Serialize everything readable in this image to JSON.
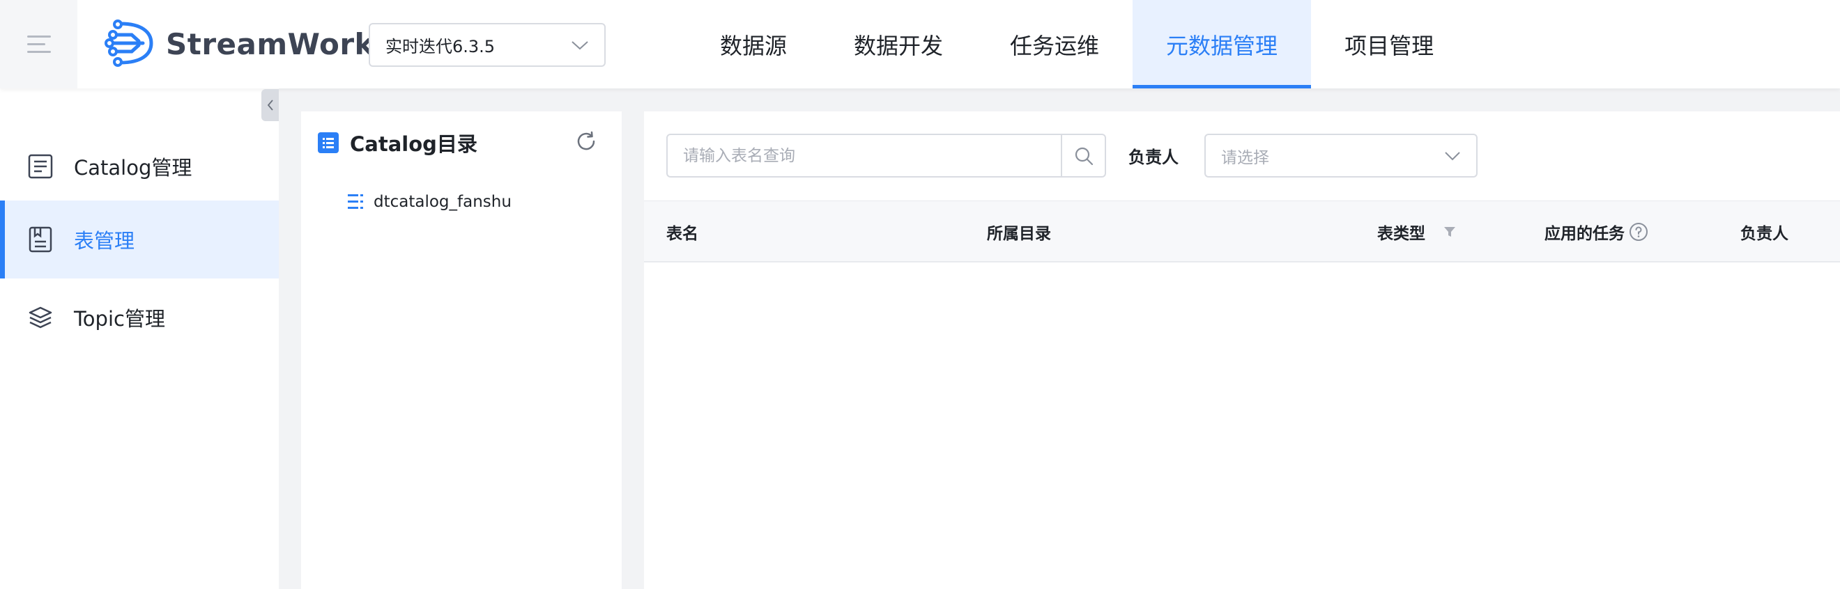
{
  "header": {
    "brand": "StreamWorks",
    "version_select": {
      "value": "实时迭代6.3.5"
    },
    "nav": [
      {
        "label": "数据源",
        "active": false
      },
      {
        "label": "数据开发",
        "active": false
      },
      {
        "label": "任务运维",
        "active": false
      },
      {
        "label": "元数据管理",
        "active": true
      },
      {
        "label": "项目管理",
        "active": false
      }
    ]
  },
  "sidebar": {
    "items": [
      {
        "label": "Catalog管理",
        "icon": "catalog-doc-icon",
        "active": false
      },
      {
        "label": "表管理",
        "icon": "table-doc-icon",
        "active": true
      },
      {
        "label": "Topic管理",
        "icon": "layers-icon",
        "active": false
      }
    ]
  },
  "catalog_panel": {
    "title": "Catalog目录",
    "tree": [
      {
        "label": "dtcatalog_fanshu",
        "icon": "list-tree-icon"
      }
    ]
  },
  "main": {
    "search": {
      "placeholder": "请输入表名查询",
      "value": ""
    },
    "owner_filter": {
      "label": "负责人",
      "placeholder": "请选择"
    },
    "table": {
      "columns": [
        "表名",
        "所属目录",
        "表类型",
        "应用的任务",
        "负责人"
      ],
      "rows": []
    }
  },
  "colors": {
    "accent": "#2b7ff6",
    "active_bg": "#e8f1ff",
    "page_bg": "#f2f3f5"
  }
}
